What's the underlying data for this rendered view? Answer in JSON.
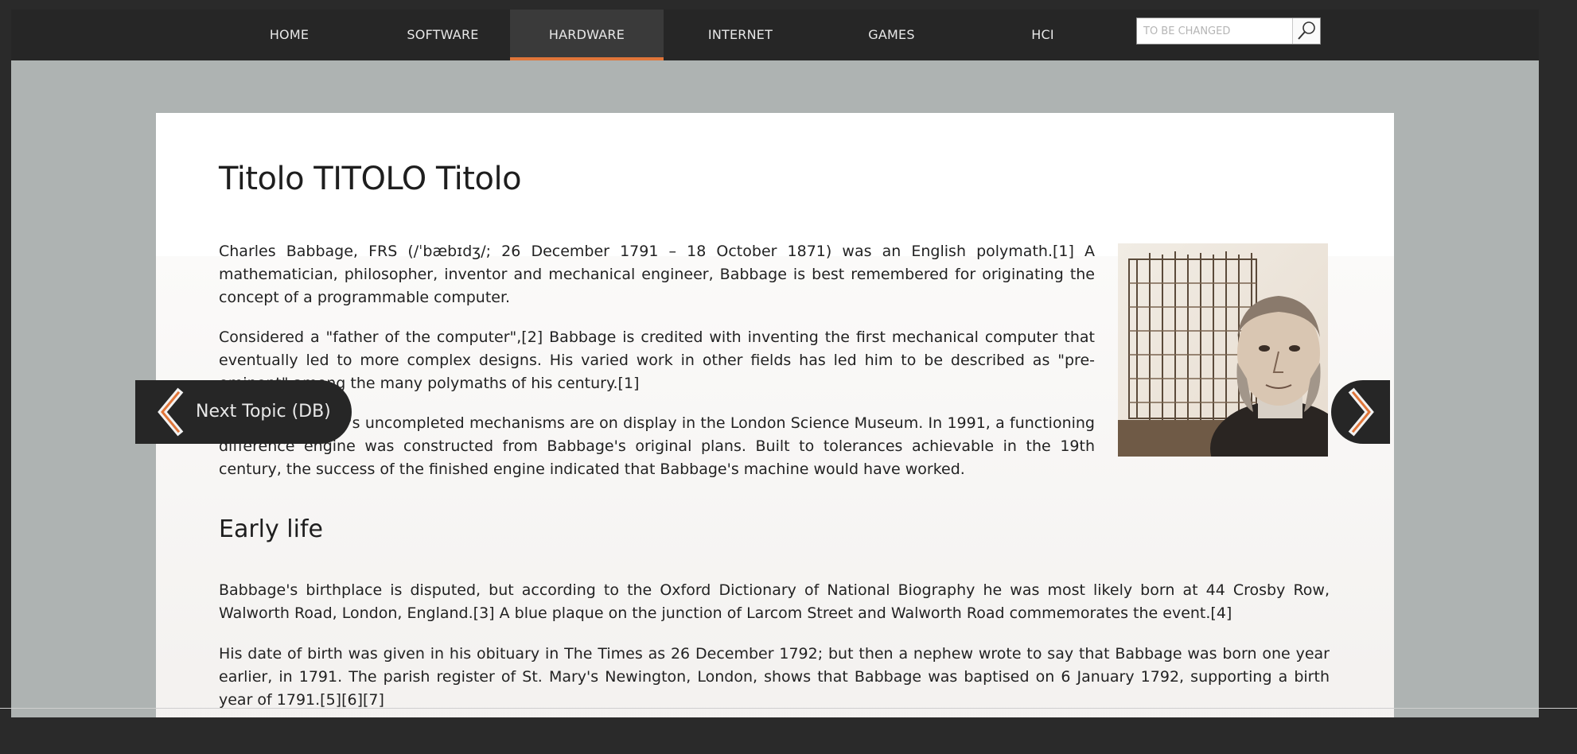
{
  "nav": {
    "items": [
      {
        "label": "HOME"
      },
      {
        "label": "SOFTWARE"
      },
      {
        "label": "HARDWARE",
        "active": true
      },
      {
        "label": "INTERNET"
      },
      {
        "label": "GAMES"
      },
      {
        "label": "HCI"
      }
    ],
    "search_placeholder": "TO BE CHANGED",
    "accent_color": "#e0763a"
  },
  "article": {
    "title": "Titolo TITOLO Titolo",
    "paragraphs": [
      "Charles Babbage, FRS (/ˈbæbɪdʒ/; 26 December 1791 – 18 October 1871) was an English polymath.[1] A mathematician, philosopher, inventor and mechanical engineer, Babbage is best remembered for originating the concept of a programmable computer.",
      "Considered a \"father of the computer\",[2] Babbage is credited with inventing the first mechanical computer that eventually led to more complex designs. His varied work in other fields has led him to be described as \"pre-eminent\" among the many polymaths of his century.[1]",
      "Parts of Babbage's uncompleted mechanisms are on display in the London Science Museum. In 1991, a functioning difference engine was constructed from Babbage's original plans. Built to tolerances achievable in the 19th century, the success of the finished engine indicated that Babbage's machine would have worked."
    ],
    "section_heading": "Early life",
    "section_paragraphs": [
      "Babbage's birthplace is disputed, but according to the Oxford Dictionary of National Biography he was most likely born at 44 Crosby Row, Walworth Road, London, England.[3] A blue plaque on the junction of Larcom Street and Walworth Road commemorates the event.[4]",
      "His date of birth was given in his obituary in The Times as 26 December 1792; but then a nephew wrote to say that Babbage was born one year earlier, in 1791. The parish register of St. Mary's Newington, London, shows that Babbage was baptised on 6 January 1792, supporting a birth year of 1791.[5][6][7]"
    ]
  },
  "pager": {
    "prev_label": "Next Topic (DB)",
    "prev_icon": "chevron-left-icon",
    "next_icon": "chevron-right-icon"
  }
}
